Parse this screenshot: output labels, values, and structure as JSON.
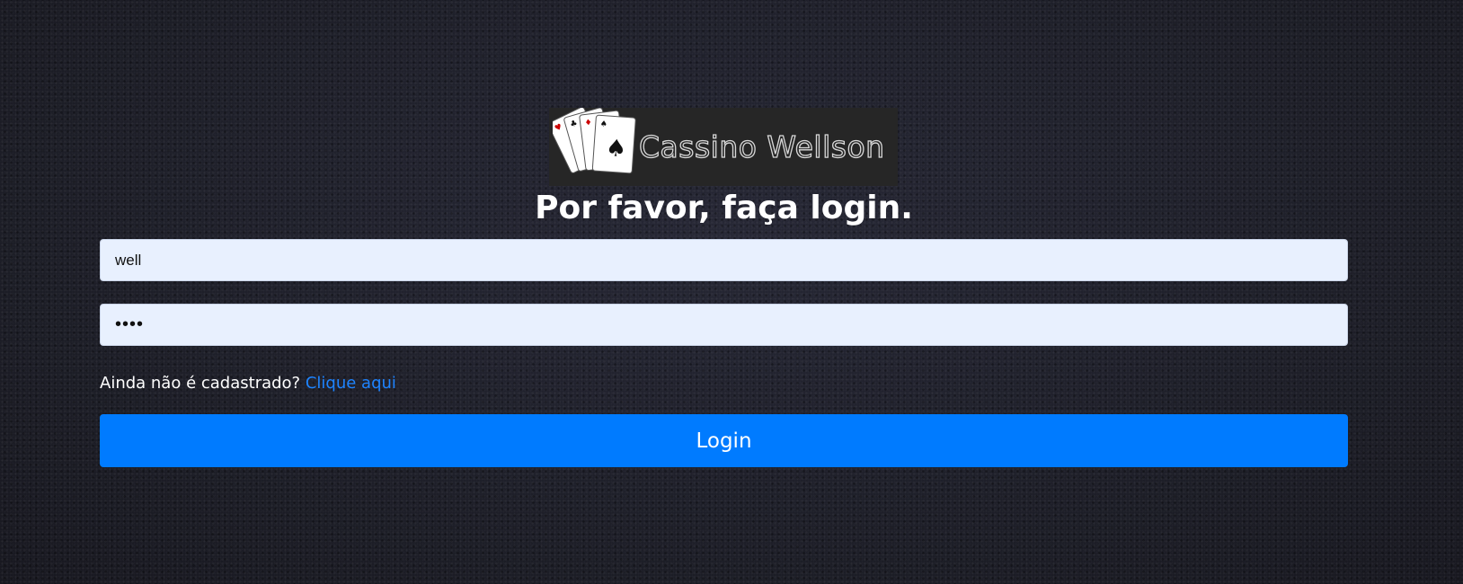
{
  "logo": {
    "text": "Cassino Wellson",
    "icon": "playing-cards-icon"
  },
  "heading": "Por favor, faça login.",
  "form": {
    "username_value": "well",
    "password_value": "well"
  },
  "signup": {
    "prompt": "Ainda não é cadastrado?",
    "link_label": "Clique aqui"
  },
  "login_button": "Login",
  "colors": {
    "accent": "#007bff",
    "link": "#1e84ff",
    "input_bg": "#e8f0fe",
    "background": "#1d1e28"
  }
}
